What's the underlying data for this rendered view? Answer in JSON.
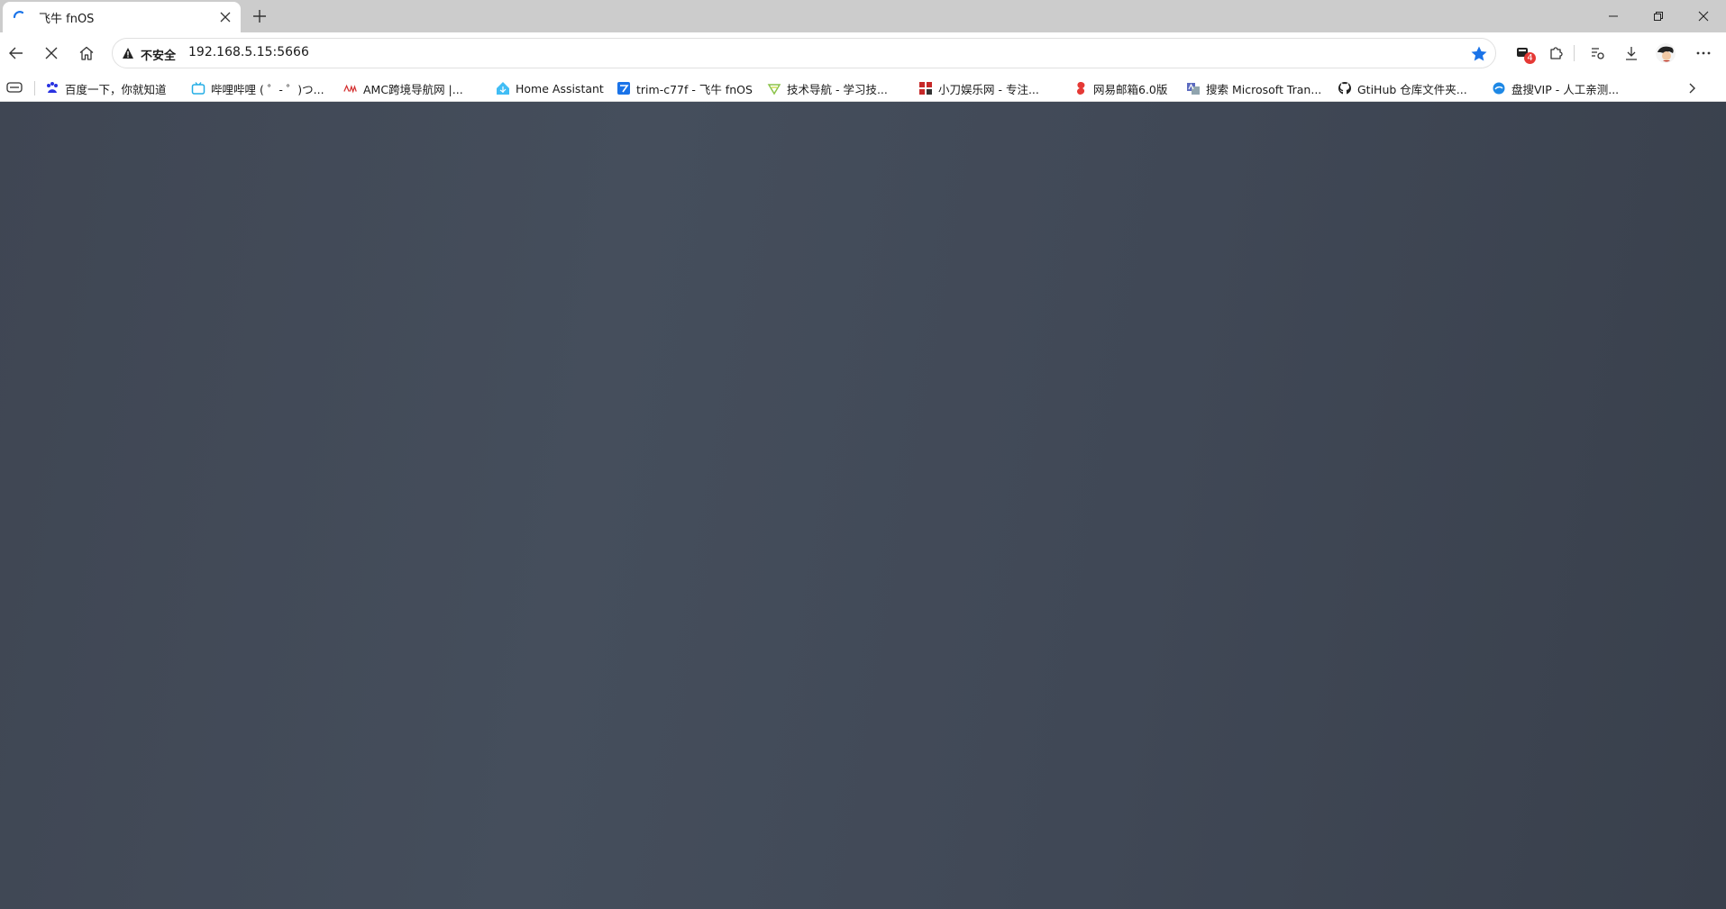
{
  "colors": {
    "titlebar": "#cccccc",
    "page_background": "#424a58",
    "accent_blue": "#1a73e8",
    "badge_red": "#e53935"
  },
  "tab": {
    "title": "飞牛 fnOS",
    "close_icon": "close-icon",
    "spinner_icon": "loading-spinner-icon"
  },
  "new_tab_symbol": "+",
  "address_bar": {
    "security_label": "不安全",
    "url": "192.168.5.15:5666"
  },
  "extension_badge": "4",
  "bookmarks": [
    {
      "label": "百度一下，你就知道",
      "icon": "baidu-icon"
    },
    {
      "label": "哔哩哔哩 ( ゜- ゜)つ...",
      "icon": "bilibili-icon"
    },
    {
      "label": "AMC跨境导航网 |...",
      "icon": "amc-icon"
    },
    {
      "label": "Home Assistant",
      "icon": "home-assistant-icon"
    },
    {
      "label": "trim-c77f - 飞牛 fnOS",
      "icon": "fnos-icon"
    },
    {
      "label": "技术导航 - 学习技...",
      "icon": "tech-nav-icon"
    },
    {
      "label": "小刀娱乐网 - 专注...",
      "icon": "xiaodao-icon"
    },
    {
      "label": "网易邮箱6.0版",
      "icon": "netease-mail-icon"
    },
    {
      "label": "搜索 Microsoft Tran...",
      "icon": "microsoft-translator-icon"
    },
    {
      "label": "GtiHub 仓库文件夹...",
      "icon": "github-icon"
    },
    {
      "label": "盘搜VIP - 人工亲测...",
      "icon": "pansou-icon"
    }
  ]
}
